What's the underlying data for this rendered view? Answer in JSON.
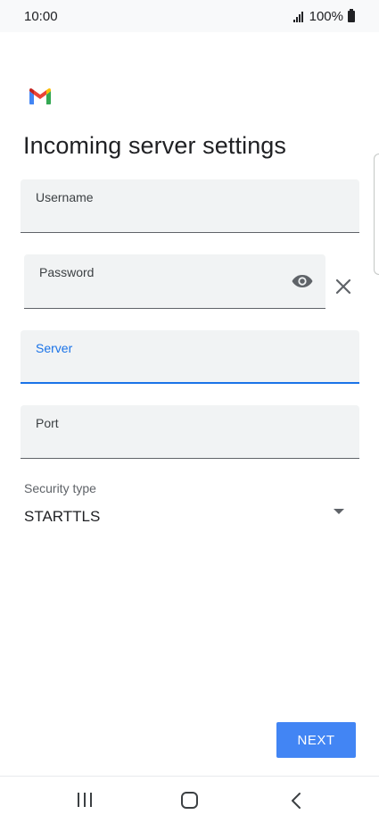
{
  "status_bar": {
    "time": "10:00",
    "battery": "100%",
    "icons": [
      "signal-icon",
      "battery-icon"
    ]
  },
  "app": {
    "logo": "gmail-logo-icon",
    "colors": {
      "accent": "#1a73e8",
      "button": "#4285f4",
      "field_bg": "#f1f3f4"
    }
  },
  "page": {
    "title": "Incoming server settings"
  },
  "form": {
    "username": {
      "label": "Username",
      "value": ""
    },
    "password": {
      "label": "Password",
      "value": "",
      "visibility_icon": "eye-icon",
      "clear_icon": "close-icon"
    },
    "server": {
      "label": "Server",
      "value": "",
      "focused": true
    },
    "port": {
      "label": "Port",
      "value": ""
    },
    "security_type": {
      "label": "Security type",
      "value": "STARTTLS",
      "icon": "dropdown-arrow-icon"
    }
  },
  "actions": {
    "next_label": "NEXT"
  },
  "nav_bar": {
    "icons": [
      "recents-icon",
      "home-icon",
      "back-icon"
    ]
  }
}
